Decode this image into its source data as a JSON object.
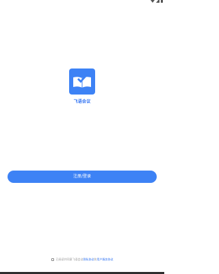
{
  "app": {
    "name": "飞语会议"
  },
  "buttons": {
    "login_label": "注册/登录"
  },
  "agreement": {
    "prefix": "已阅读并同意飞语会议",
    "privacy_link": "隐私协议",
    "conjunction": "和",
    "service_link": "用户服务协议"
  },
  "colors": {
    "brand": "#3d82f5",
    "link": "#2b6ff2"
  },
  "icons": {
    "logo": "book-bird-logo-icon",
    "wifi": "wifi-icon",
    "signal": "signal-icon"
  }
}
